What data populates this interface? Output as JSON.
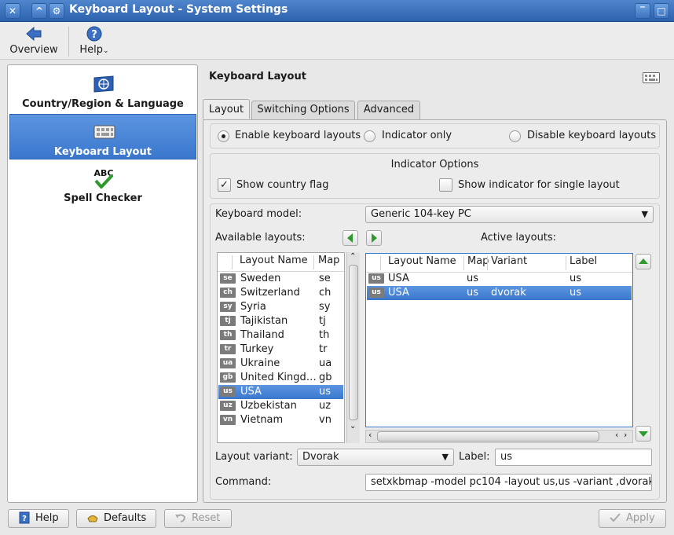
{
  "window": {
    "title": "Keyboard Layout - System Settings"
  },
  "toolbar": {
    "overview_label": "Overview",
    "help_label": "Help"
  },
  "sidebar": {
    "items": [
      {
        "label": "Country/Region & Language",
        "icon": "globe-flag-icon"
      },
      {
        "label": "Keyboard Layout",
        "icon": "keyboard-icon"
      },
      {
        "label": "Spell Checker",
        "icon": "spellcheck-icon"
      }
    ]
  },
  "main": {
    "title": "Keyboard Layout",
    "tabs": [
      {
        "label": "Layout"
      },
      {
        "label": "Switching Options"
      },
      {
        "label": "Advanced"
      }
    ],
    "modes": {
      "enable": "Enable keyboard layouts",
      "indicator_only": "Indicator only",
      "disable": "Disable keyboard layouts",
      "selected": "enable"
    },
    "indicator": {
      "title": "Indicator Options",
      "show_flag": "Show country flag",
      "show_flag_checked": true,
      "single_layout": "Show indicator for single layout",
      "single_layout_checked": false
    },
    "keyboard_model_label": "Keyboard model:",
    "keyboard_model_value": "Generic 104-key PC",
    "available_label": "Available layouts:",
    "active_label": "Active layouts:",
    "available": {
      "headers": [
        "Layout Name",
        "Map"
      ],
      "rows": [
        {
          "flag": "se",
          "name": "Sweden",
          "map": "se"
        },
        {
          "flag": "ch",
          "name": "Switzerland",
          "map": "ch"
        },
        {
          "flag": "sy",
          "name": "Syria",
          "map": "sy"
        },
        {
          "flag": "tj",
          "name": "Tajikistan",
          "map": "tj"
        },
        {
          "flag": "th",
          "name": "Thailand",
          "map": "th"
        },
        {
          "flag": "tr",
          "name": "Turkey",
          "map": "tr"
        },
        {
          "flag": "ua",
          "name": "Ukraine",
          "map": "ua"
        },
        {
          "flag": "gb",
          "name": "United Kingd…",
          "map": "gb"
        },
        {
          "flag": "us",
          "name": "USA",
          "map": "us"
        },
        {
          "flag": "uz",
          "name": "Uzbekistan",
          "map": "uz"
        },
        {
          "flag": "vn",
          "name": "Vietnam",
          "map": "vn"
        }
      ]
    },
    "active": {
      "headers": [
        "Layout Name",
        "Map",
        "Variant",
        "Label"
      ],
      "rows": [
        {
          "flag": "us",
          "name": "USA",
          "map": "us",
          "variant": "",
          "label": "us"
        },
        {
          "flag": "us",
          "name": "USA",
          "map": "us",
          "variant": "dvorak",
          "label": "us"
        }
      ]
    },
    "variant_label": "Layout variant:",
    "variant_value": "Dvorak",
    "label_label": "Label:",
    "label_value": "us",
    "command_label": "Command:",
    "command_value": "setxkbmap -model pc104 -layout us,us -variant ,dvorak"
  },
  "buttons": {
    "help": "Help",
    "defaults": "Defaults",
    "reset": "Reset",
    "apply": "Apply"
  },
  "colors": {
    "selection": "#3a77cd",
    "titlebar": "#2d62ad"
  }
}
